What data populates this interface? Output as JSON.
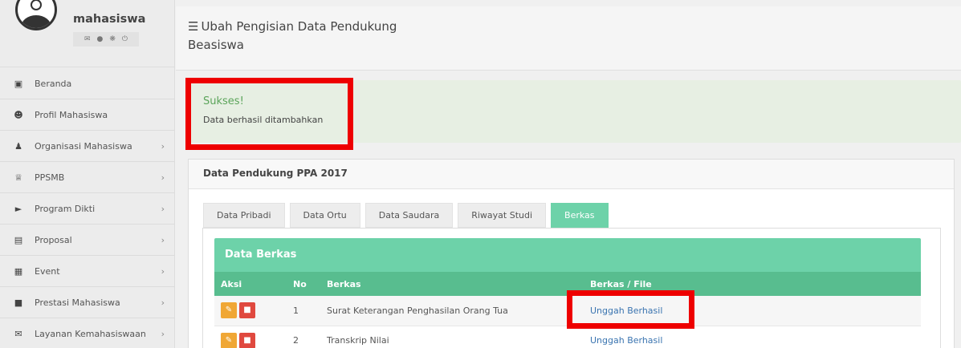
{
  "sidebar": {
    "username": "mahasiswa",
    "profile_icons": [
      "envelope-icon",
      "user-icon",
      "gear-icon",
      "power-icon"
    ],
    "items": [
      {
        "label": "Beranda",
        "icon": "monitor-icon",
        "chevron": false
      },
      {
        "label": "Profil Mahasiswa",
        "icon": "user-icon",
        "chevron": false
      },
      {
        "label": "Organisasi Mahasiswa",
        "icon": "users-icon",
        "chevron": true
      },
      {
        "label": "PPSMB",
        "icon": "trophy-icon",
        "chevron": true
      },
      {
        "label": "Program Dikti",
        "icon": "tag-icon",
        "chevron": true
      },
      {
        "label": "Proposal",
        "icon": "file-icon",
        "chevron": true
      },
      {
        "label": "Event",
        "icon": "calendar-icon",
        "chevron": true
      },
      {
        "label": "Prestasi Mahasiswa",
        "icon": "gift-icon",
        "chevron": true
      },
      {
        "label": "Layanan Kemahasiswaan",
        "icon": "envelope-icon",
        "chevron": true
      }
    ]
  },
  "header": {
    "title_line1": "Ubah Pengisian Data Pendukung",
    "title_line2": "Beasiswa"
  },
  "alert": {
    "title": "Sukses!",
    "message": "Data berhasil ditambahkan"
  },
  "panel": {
    "title": "Data Pendukung PPA 2017",
    "tabs": [
      {
        "label": "Data Pribadi",
        "active": false
      },
      {
        "label": "Data Ortu",
        "active": false
      },
      {
        "label": "Data Saudara",
        "active": false
      },
      {
        "label": "Riwayat Studi",
        "active": false
      },
      {
        "label": "Berkas",
        "active": true
      }
    ]
  },
  "berkas": {
    "heading": "Data Berkas",
    "columns": [
      "Aksi",
      "No",
      "Berkas",
      "Berkas / File"
    ],
    "rows": [
      {
        "no": "1",
        "berkas": "Surat Keterangan Penghasilan Orang Tua",
        "file": "Unggah Berhasil"
      },
      {
        "no": "2",
        "berkas": "Transkrip Nilai",
        "file": "Unggah Berhasil"
      }
    ]
  },
  "colors": {
    "accent_green": "#6dd2a9",
    "header_green": "#58bd8f",
    "success_text": "#5ba45a",
    "edit_orange": "#f0a735",
    "delete_red": "#e0493f",
    "highlight_red": "#ee0000",
    "link_blue": "#3a74b0"
  }
}
